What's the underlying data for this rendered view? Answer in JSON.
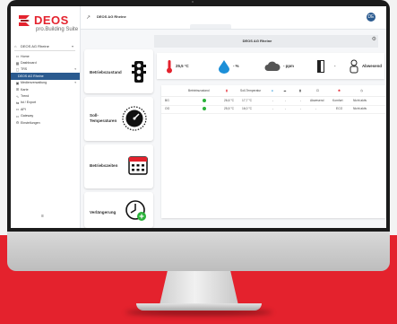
{
  "header": {
    "page_title": "DEOS AG Rheine",
    "user_initials": "DE"
  },
  "brand": {
    "name": "DEOS",
    "tagline": "pro.Building Suite",
    "color": "#e4222d"
  },
  "sidebar": {
    "site_selector": "DEOS AG Rheine",
    "items": [
      {
        "label": "Home",
        "icon": "home-icon"
      },
      {
        "label": "Dashboard",
        "icon": "dashboard-icon"
      },
      {
        "label": "TRS",
        "icon": "folder-icon"
      },
      {
        "label": "DEOS AG Rheine",
        "icon": "",
        "active": true
      },
      {
        "label": "Medienverwaltung",
        "icon": "media-icon"
      },
      {
        "label": "Karte",
        "icon": "map-icon"
      },
      {
        "label": "Trend",
        "icon": "trend-icon"
      },
      {
        "label": "Ist / Export",
        "icon": "export-icon"
      },
      {
        "label": "API",
        "icon": "api-icon"
      },
      {
        "label": "Gateway",
        "icon": "gateway-icon"
      },
      {
        "label": "Einstellungen",
        "icon": "settings-icon"
      }
    ]
  },
  "room": {
    "title": "DEOS AG Rheine"
  },
  "cards": [
    {
      "label": "Betriebszustand",
      "icon": "traffic-light-icon"
    },
    {
      "label": "Soll-Temperaturen",
      "icon": "thermostat-dial-icon"
    },
    {
      "label": "Betriebszeiten",
      "icon": "calendar-icon"
    },
    {
      "label": "Verlängerung",
      "icon": "clock-extend-icon"
    }
  ],
  "metrics": [
    {
      "icon": "thermometer-icon",
      "value": "25,5 °C"
    },
    {
      "icon": "humidity-icon",
      "value": "- %"
    },
    {
      "icon": "co2-icon",
      "value": "- ppm"
    },
    {
      "icon": "window-icon",
      "value": "-"
    },
    {
      "icon": "presence-icon",
      "value": "Abwesend"
    }
  ],
  "table": {
    "headers": [
      "",
      "Betriebszustand",
      "",
      "Soll-Temperatur",
      "",
      "",
      "",
      "",
      "",
      ""
    ],
    "rows": [
      [
        "BG",
        "",
        "26,6 °C",
        "17,7 °C",
        "-",
        "-",
        "-",
        "Abwesend",
        "Komfort",
        "Nicht aktiv"
      ],
      [
        "OG",
        "",
        "25,5 °C",
        "16,0 °C",
        "-",
        "-",
        "-",
        "-",
        "ECO",
        "Nicht aktiv"
      ]
    ]
  },
  "colors": {
    "nav_active": "#2a5a8f",
    "status_ok": "#2bb23a",
    "background_red": "#e4222d"
  }
}
